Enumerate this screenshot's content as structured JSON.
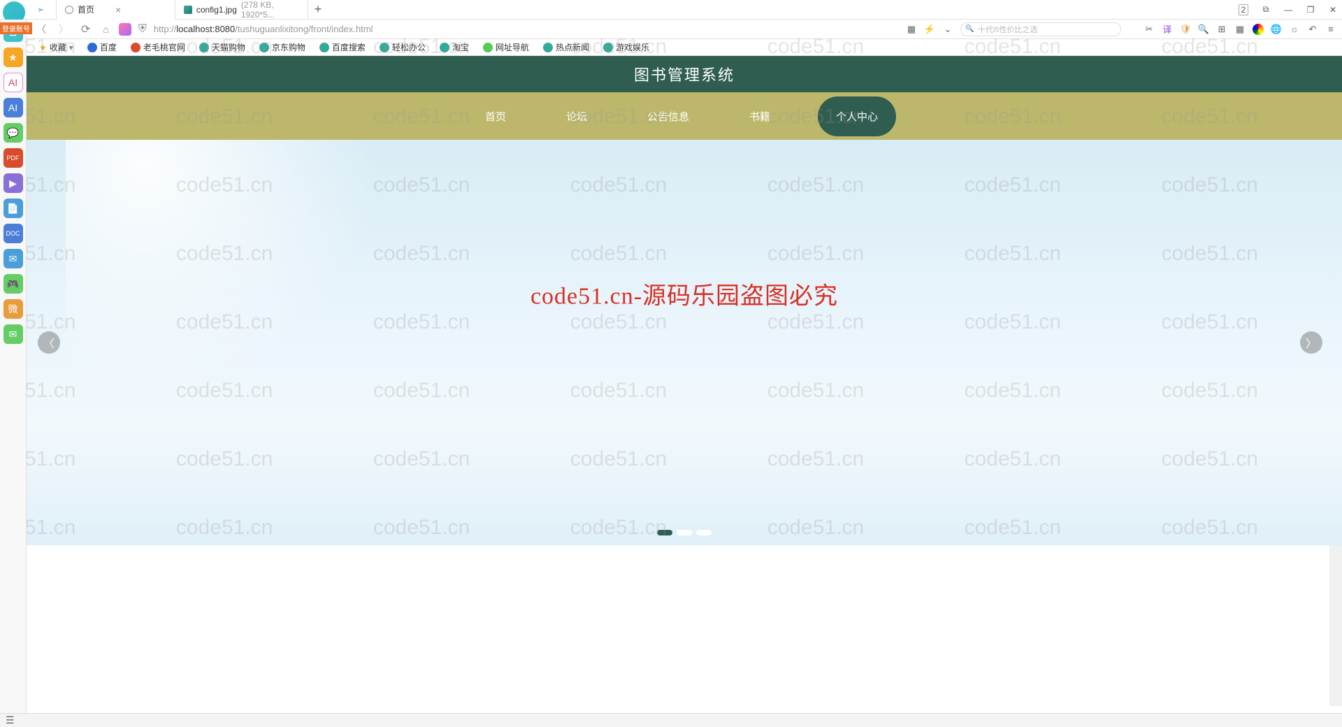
{
  "browser": {
    "tabs": [
      {
        "title": "首页",
        "active": true
      },
      {
        "title": "config1.jpg",
        "meta": "(278 KB, 1920*5...",
        "active": false
      }
    ],
    "url_prefix": "http://",
    "url_host": "localhost:8080",
    "url_path": "/tushuguanlixitong/front/index.html",
    "search_placeholder": "十代i5性价比之选",
    "badge_count": "2",
    "window_controls": {
      "min": "—",
      "max": "❐",
      "close": "✕"
    }
  },
  "bookmarks": {
    "fav_label": "收藏",
    "items": [
      "百度",
      "老毛桃官网",
      "天猫购物",
      "京东购物",
      "百度搜索",
      "轻松办公",
      "淘宝",
      "网址导航",
      "热点新闻",
      "游戏娱乐"
    ]
  },
  "login_tag": "登录账号",
  "app": {
    "title": "图书管理系统",
    "nav": [
      "首页",
      "论坛",
      "公告信息",
      "书籍",
      "个人中心"
    ],
    "active_nav_index": 4,
    "hero_text": "code51.cn-源码乐园盗图必究",
    "carousel_total": 3,
    "carousel_active": 0
  },
  "watermark_text": "code51.cn"
}
